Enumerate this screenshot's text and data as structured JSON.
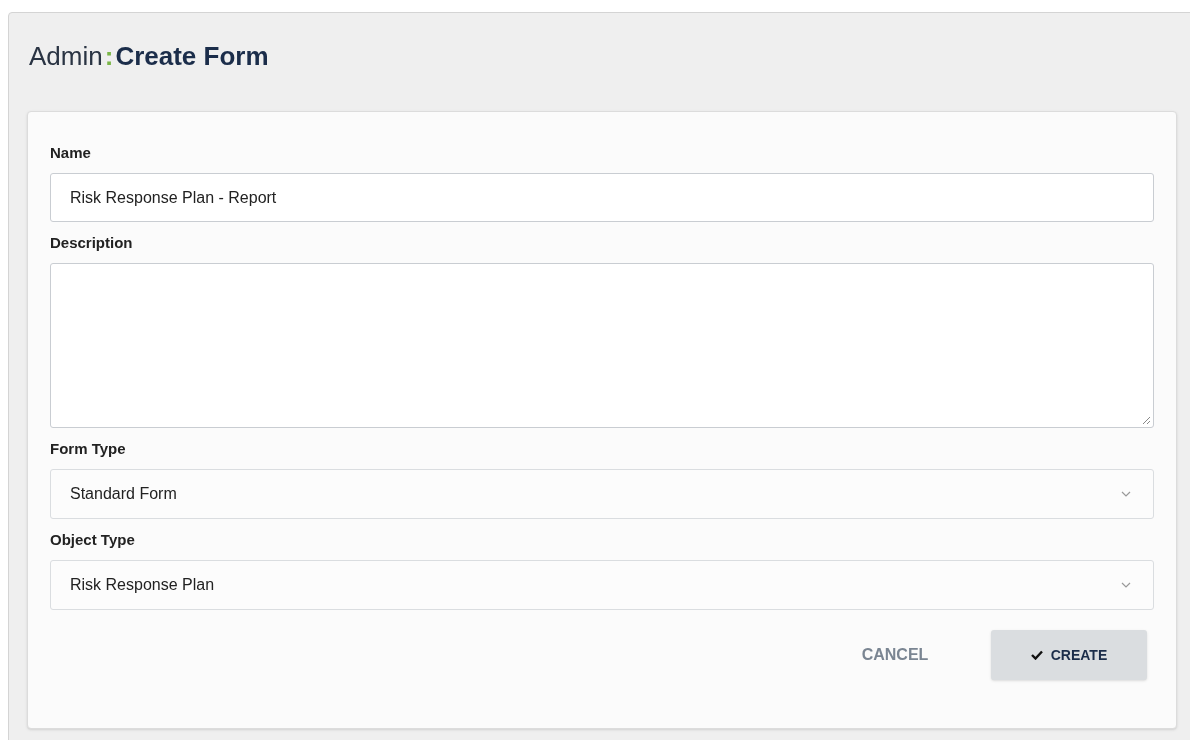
{
  "header": {
    "section": "Admin",
    "separator": ":",
    "title": "Create Form"
  },
  "fields": [
    {
      "kind": "text",
      "label": "Name",
      "value": "Risk Response Plan - Report"
    },
    {
      "kind": "textarea",
      "label": "Description"
    },
    {
      "kind": "select",
      "label": "Form Type",
      "value": "Standard Form"
    },
    {
      "kind": "select",
      "label": "Object Type",
      "value": "Risk Response Plan"
    }
  ],
  "buttons": [
    {
      "kind": "flat",
      "label": "CANCEL"
    },
    {
      "kind": "raised",
      "label": "CREATE"
    }
  ]
}
